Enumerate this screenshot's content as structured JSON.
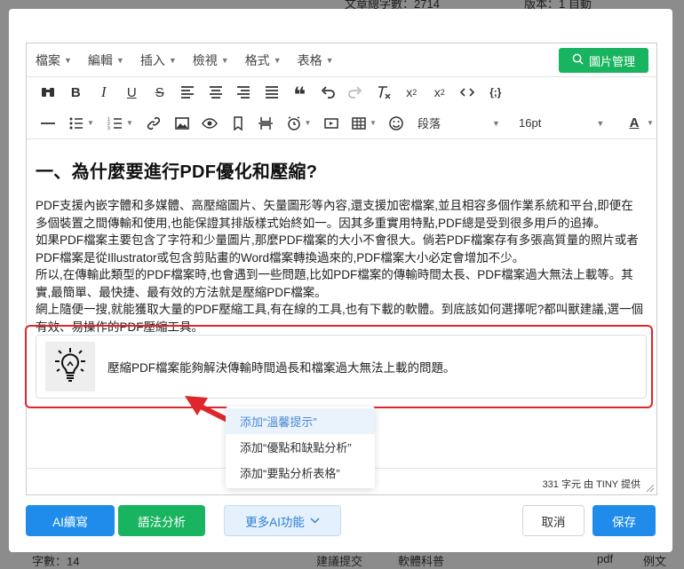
{
  "background": {
    "top_left_text": "文章總字數：2714",
    "top_right_text": "版本：1 自動",
    "bottom_items": [
      "字數：14",
      "建議提交",
      "軟體科普",
      "pdf",
      "例文"
    ]
  },
  "menubar": {
    "items": [
      "檔案",
      "編輯",
      "插入",
      "檢視",
      "格式",
      "表格"
    ],
    "image_manager_label": "圖片管理"
  },
  "toolbar": {
    "paragraph_label": "段落",
    "font_size_label": "16pt"
  },
  "content": {
    "heading": "一、為什麼要進行PDF優化和壓縮?",
    "paragraphs": [
      "PDF支援內嵌字體和多媒體、高壓縮圖片、矢量圖形等內容,還支援加密檔案,並且相容多個作業系統和平台,即便在多個裝置之間傳輸和使用,也能保證其排版樣式始終如一。因其多重實用特點,PDF總是受到很多用戶的追捧。",
      "如果PDF檔案主要包含了字符和少量圖片,那麼PDF檔案的大小不會很大。倘若PDF檔案存有多張高質量的照片或者PDF檔案是從Illustrator或包含剪貼畫的Word檔案轉換過來的,PDF檔案大小必定會增加不少。",
      "所以,在傳輸此類型的PDF檔案時,也會遇到一些問題,比如PDF檔案的傳輸時間太長、PDF檔案過大無法上載等。其實,最簡單、最快捷、最有效的方法就是壓縮PDF檔案。",
      "網上隨便一搜,就能獲取大量的PDF壓縮工具,有在線的工具,也有下載的軟體。到底該如何選擇呢?都叫獸建議,選一個有效、易操作的PDF壓縮工具。"
    ],
    "tip_text": "壓縮PDF檔案能夠解決傳輸時間過長和檔案過大無法上載的問題。"
  },
  "statusbar": {
    "word_count": "331 字元 由 TINY 提供"
  },
  "dropdown": {
    "items": [
      "添加“溫馨提示”",
      "添加“優點和缺點分析”",
      "添加“要點分析表格”"
    ]
  },
  "buttons": {
    "ai_continue": "AI續寫",
    "grammar": "語法分析",
    "more_ai": "更多AI功能",
    "cancel": "取消",
    "save": "保存"
  },
  "colors": {
    "primary_blue": "#1f8ceb",
    "green": "#19b45f",
    "highlight_red": "#e0262a"
  }
}
